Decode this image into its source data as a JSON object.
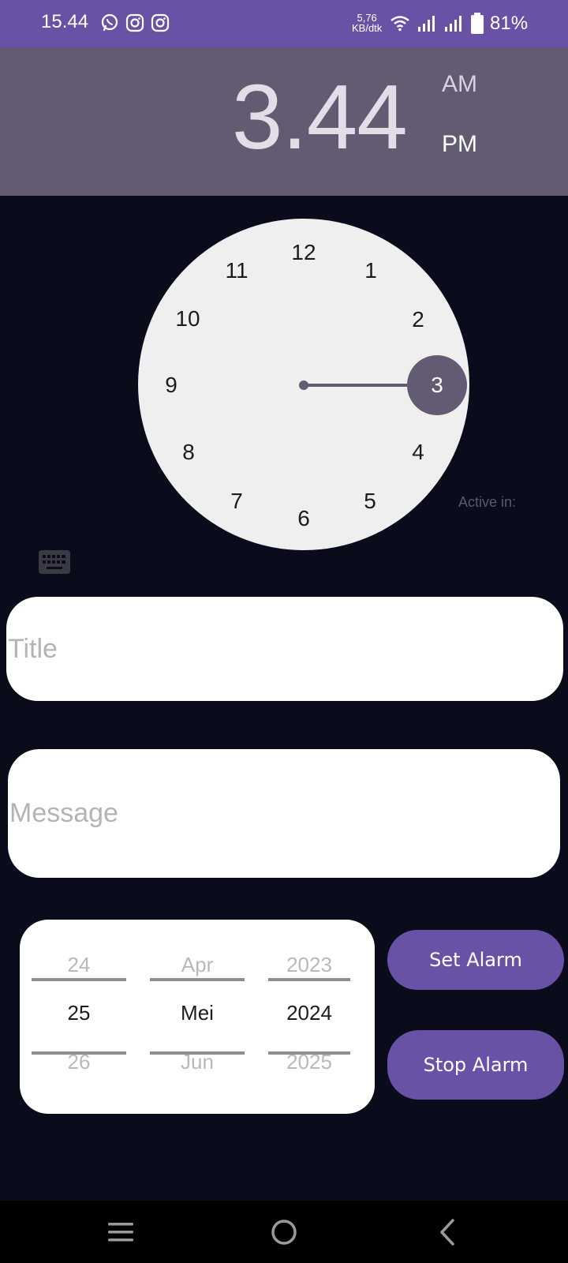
{
  "status_bar": {
    "time": "15.44",
    "network_speed_value": "5,76",
    "network_speed_unit": "KB/dtk",
    "battery": "81%",
    "app_icons": [
      "whatsapp-icon",
      "instagram-icon",
      "instagram-icon"
    ]
  },
  "time_header": {
    "hour": "3",
    "minute": "44",
    "separator": ".",
    "am_label": "AM",
    "pm_label": "PM",
    "selected_period": "PM"
  },
  "clock": {
    "numbers": [
      "12",
      "1",
      "2",
      "3",
      "4",
      "5",
      "6",
      "7",
      "8",
      "9",
      "10",
      "11"
    ],
    "selected": "3",
    "active_in_label": "Active in:"
  },
  "form": {
    "title_placeholder": "Title",
    "title_value": "",
    "message_placeholder": "Message",
    "message_value": ""
  },
  "date_picker": {
    "day": {
      "prev": "24",
      "current": "25",
      "next": "26"
    },
    "month": {
      "prev": "Apr",
      "current": "Mei",
      "next": "Jun"
    },
    "year": {
      "prev": "2023",
      "current": "2024",
      "next": "2025"
    }
  },
  "buttons": {
    "set_alarm": "Set Alarm",
    "stop_alarm": "Stop Alarm"
  },
  "colors": {
    "accent": "#6952a6",
    "header": "#625b71",
    "background": "#0b0c1b",
    "clock_face": "#efeff0"
  },
  "nav_bar": {
    "icons": [
      "menu-icon",
      "home-icon",
      "back-icon"
    ]
  }
}
